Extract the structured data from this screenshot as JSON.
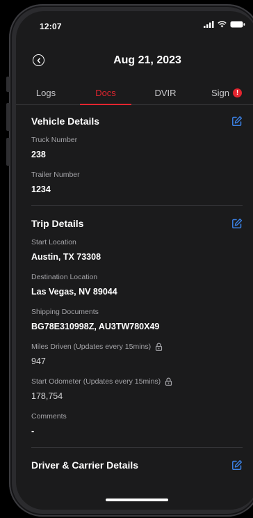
{
  "status_bar": {
    "time": "12:07",
    "icons": [
      "signal-icon",
      "wifi-icon",
      "battery-icon"
    ]
  },
  "header": {
    "title": "Aug 21, 2023",
    "back_icon": "chevron-left-circle-icon"
  },
  "tabs": [
    {
      "label": "Logs",
      "active": false
    },
    {
      "label": "Docs",
      "active": true
    },
    {
      "label": "DVIR",
      "active": false
    },
    {
      "label": "Sign",
      "active": false,
      "badge": "!"
    }
  ],
  "vehicle_details": {
    "title": "Vehicle Details",
    "truck_number_label": "Truck Number",
    "truck_number": "238",
    "trailer_number_label": "Trailer Number",
    "trailer_number": "1234"
  },
  "trip_details": {
    "title": "Trip Details",
    "start_location_label": "Start Location",
    "start_location": "Austin, TX 73308",
    "destination_label": "Destination Location",
    "destination": "Las Vegas, NV 89044",
    "shipping_docs_label": "Shipping Documents",
    "shipping_docs": "BG78E310998Z, AU3TW780X49",
    "miles_driven_label": "Miles Driven (Updates every 15mins)",
    "miles_driven": "947",
    "start_odometer_label": "Start Odometer (Updates every 15mins)",
    "start_odometer": "178,754",
    "comments_label": "Comments",
    "comments": "-"
  },
  "driver_carrier": {
    "title": "Driver & Carrier Details"
  },
  "colors": {
    "accent": "#e3252f",
    "edit_icon": "#3b82e6",
    "background": "#1b1b1c"
  }
}
